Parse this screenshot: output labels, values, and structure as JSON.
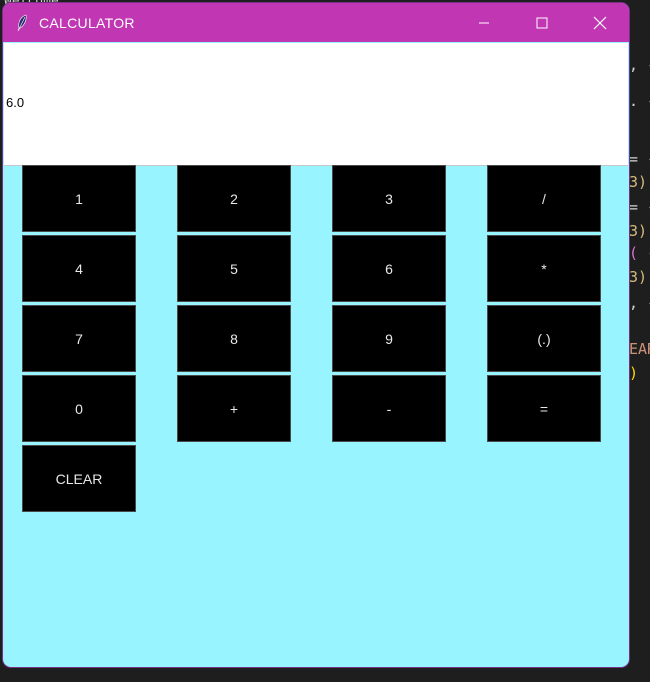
{
  "window": {
    "title": "CALCULATOR",
    "icon": "feather-icon",
    "controls": {
      "minimize_icon": "minimize-icon",
      "maximize_icon": "maximize-icon",
      "close_icon": "close-icon"
    },
    "title_bar_color": "#c136b3",
    "body_color": "#98f5ff"
  },
  "display": {
    "value": "6.0"
  },
  "keys": {
    "k1": "1",
    "k2": "2",
    "k3": "3",
    "div": "/",
    "k4": "4",
    "k5": "5",
    "k6": "6",
    "mul": "*",
    "k7": "7",
    "k8": "8",
    "k9": "9",
    "dot": "(.)",
    "k0": "0",
    "add": "+",
    "sub": "-",
    "eq": "=",
    "clear": "CLEAR"
  },
  "background_editor": {
    "lines": [
      "Welcome",
      ", ‹",
      ". ‹",
      "= ‹",
      " 3)",
      "= ‹",
      " 3)",
      "( ‹",
      "3)",
      ", ‹",
      "EAR",
      ")"
    ]
  }
}
